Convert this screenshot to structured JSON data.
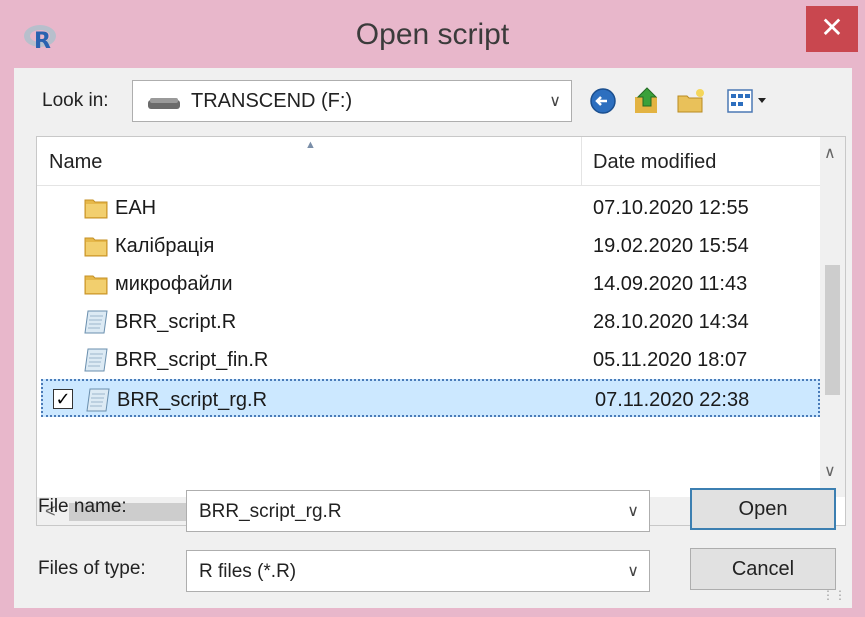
{
  "window": {
    "title": "Open script",
    "close_glyph": "✕",
    "accent": "#c9474f"
  },
  "lookin": {
    "label": "Look in:",
    "value": "TRANSCEND (F:)"
  },
  "toolbar": {
    "icons": [
      "back-icon",
      "up-folder-icon",
      "new-folder-icon",
      "view-menu-icon"
    ]
  },
  "list": {
    "columns": {
      "name": "Name",
      "date": "Date modified"
    },
    "rows": [
      {
        "name": "ЕАН",
        "date": "07.10.2020 12:55",
        "type": "folder"
      },
      {
        "name": "Калібрація",
        "date": "19.02.2020 15:54",
        "type": "folder"
      },
      {
        "name": "микрофайли",
        "date": "14.09.2020 11:43",
        "type": "folder"
      },
      {
        "name": "BRR_script.R",
        "date": "28.10.2020 14:34",
        "type": "file"
      },
      {
        "name": "BRR_script_fin.R",
        "date": "05.11.2020 18:07",
        "type": "file"
      },
      {
        "name": "BRR_script_rg.R",
        "date": "07.11.2020 22:38",
        "type": "file",
        "selected": true
      }
    ]
  },
  "filename": {
    "label": "File name:",
    "value": "BRR_script_rg.R"
  },
  "filetype": {
    "label": "Files of type:",
    "value": "R files (*.R)"
  },
  "buttons": {
    "open": "Open",
    "cancel": "Cancel"
  }
}
